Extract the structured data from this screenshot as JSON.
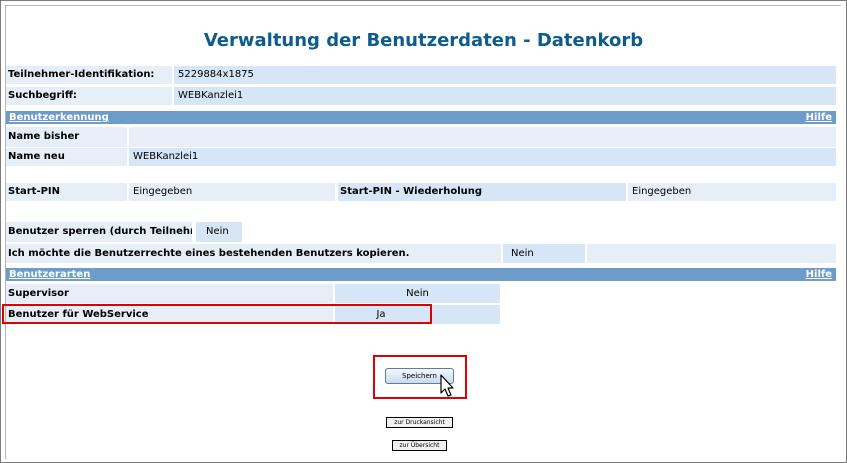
{
  "page": {
    "title": "Verwaltung der Benutzerdaten - Datenkorb"
  },
  "info": {
    "teilnehmer_label": "Teilnehmer-Identifikation:",
    "teilnehmer_value": "5229884x1875",
    "suchbegriff_label": "Suchbegriff:",
    "suchbegriff_value": "WEBKanzlei1"
  },
  "benutzerkennung": {
    "section_title": "Benutzerkennung",
    "help": "Hilfe",
    "name_bisher_label": "Name bisher",
    "name_bisher_value": "",
    "name_neu_label": "Name neu",
    "name_neu_value": "WEBKanzlei1",
    "start_pin_label": "Start-PIN",
    "start_pin_value": "Eingegeben",
    "start_pin_repeat_label": "Start-PIN - Wiederholung",
    "start_pin_repeat_value": "Eingegeben",
    "sperren_label": "Benutzer sperren (durch Teilnehmer)",
    "sperren_value": "Nein",
    "kopieren_label": "Ich möchte die Benutzerrechte eines bestehenden Benutzers kopieren.",
    "kopieren_value": "Nein"
  },
  "benutzerarten": {
    "section_title": "Benutzerarten",
    "help": "Hilfe",
    "supervisor_label": "Supervisor",
    "supervisor_value": "Nein",
    "webservice_label": "Benutzer für WebService",
    "webservice_value": "Ja"
  },
  "actions": {
    "save_label": "Speichern",
    "print_view_label": "zur Druckansicht",
    "overview_label": "zur Übersicht"
  },
  "colors": {
    "title": "#0e5c8c",
    "section_header": "#6d9ccb",
    "label_bg": "#e6eef8",
    "value_bg": "#d6e6f6",
    "highlight": "#e00000"
  }
}
